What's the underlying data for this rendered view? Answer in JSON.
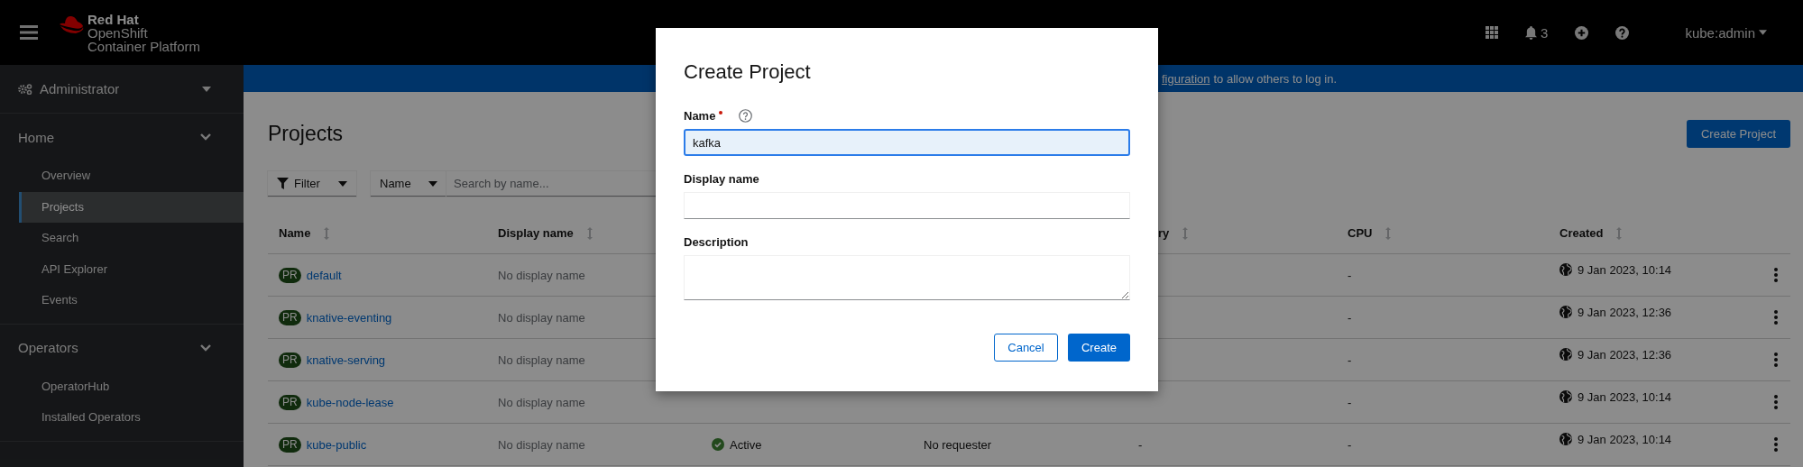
{
  "header": {
    "brand": [
      "Red Hat",
      "OpenShift",
      "Container Platform"
    ],
    "notifications": "3",
    "user": "kube:admin"
  },
  "sidebar": {
    "perspective": "Administrator",
    "sections": [
      {
        "label": "Home",
        "expanded": true,
        "items": [
          {
            "label": "Overview",
            "selected": false
          },
          {
            "label": "Projects",
            "selected": true
          },
          {
            "label": "Search",
            "selected": false
          },
          {
            "label": "API Explorer",
            "selected": false
          },
          {
            "label": "Events",
            "selected": false
          }
        ]
      },
      {
        "label": "Operators",
        "expanded": true,
        "items": [
          {
            "label": "OperatorHub",
            "selected": false
          },
          {
            "label": "Installed Operators",
            "selected": false
          }
        ]
      }
    ]
  },
  "banner": {
    "link": "figuration",
    "text": "to allow others to log in."
  },
  "page": {
    "title": "Projects",
    "create_button": "Create Project",
    "filter": {
      "label": "Filter",
      "attribute": "Name",
      "placeholder": "Search by name..."
    }
  },
  "table": {
    "columns": [
      {
        "label": "Name"
      },
      {
        "label": "Display name"
      },
      {},
      {},
      {
        "label": "ry"
      },
      {
        "label": "CPU"
      },
      {
        "label": "Created"
      }
    ],
    "rows": [
      {
        "badge": "PR",
        "name": "default",
        "display_name": "No display name",
        "cpu": "-",
        "created": "9 Jan 2023, 10:14"
      },
      {
        "badge": "PR",
        "name": "knative-eventing",
        "display_name": "No display name",
        "cpu": "-",
        "created": "9 Jan 2023, 12:36"
      },
      {
        "badge": "PR",
        "name": "knative-serving",
        "display_name": "No display name",
        "cpu": "-",
        "created": "9 Jan 2023, 12:36"
      },
      {
        "badge": "PR",
        "name": "kube-node-lease",
        "display_name": "No display name",
        "cpu": "-",
        "created": "9 Jan 2023, 10:14"
      },
      {
        "badge": "PR",
        "name": "kube-public",
        "display_name": "No display name",
        "status": "Active",
        "requester": "No requester",
        "memory": "-",
        "cpu": "-",
        "created": "9 Jan 2023, 10:14"
      }
    ]
  },
  "modal": {
    "title": "Create Project",
    "fields": [
      {
        "kind": "input",
        "label": "Name",
        "required": true,
        "help": true,
        "value": "kafka",
        "focused": true
      },
      {
        "kind": "input",
        "label": "Display name",
        "required": false,
        "help": false,
        "focused": false
      },
      {
        "kind": "textarea",
        "label": "Description",
        "required": false,
        "help": false,
        "focused": false
      }
    ],
    "buttons": [
      {
        "label": "Cancel",
        "kind": "secondary"
      },
      {
        "label": "Create",
        "kind": "primary"
      }
    ]
  }
}
